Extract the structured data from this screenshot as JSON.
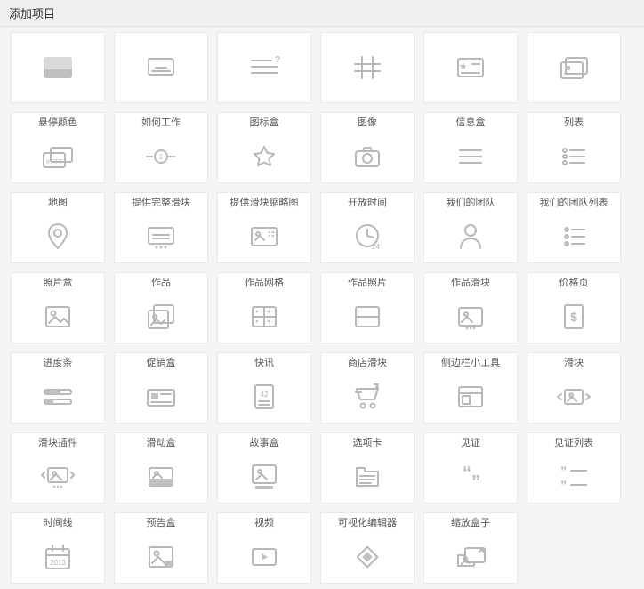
{
  "header": {
    "title": "添加项目"
  },
  "tiles": [
    {
      "label": "",
      "icon": "rect-split"
    },
    {
      "label": "",
      "icon": "card-lines"
    },
    {
      "label": "",
      "icon": "lines-question"
    },
    {
      "label": "",
      "icon": "hash"
    },
    {
      "label": "",
      "icon": "card-star"
    },
    {
      "label": "",
      "icon": "media-stack"
    },
    {
      "label": "悬停颜色",
      "icon": "hover-color"
    },
    {
      "label": "如何工作",
      "icon": "how-works"
    },
    {
      "label": "图标盒",
      "icon": "star"
    },
    {
      "label": "图像",
      "icon": "camera"
    },
    {
      "label": "信息盒",
      "icon": "list-lines"
    },
    {
      "label": "列表",
      "icon": "list-dots"
    },
    {
      "label": "地图",
      "icon": "pin"
    },
    {
      "label": "提供完整滑块",
      "icon": "slider-full"
    },
    {
      "label": "提供滑块缩略图",
      "icon": "slider-thumb"
    },
    {
      "label": "开放时间",
      "icon": "clock-24"
    },
    {
      "label": "我们的团队",
      "icon": "person"
    },
    {
      "label": "我们的团队列表",
      "icon": "person-list"
    },
    {
      "label": "照片盒",
      "icon": "image"
    },
    {
      "label": "作品",
      "icon": "image-stack"
    },
    {
      "label": "作品网格",
      "icon": "grid-4"
    },
    {
      "label": "作品照片",
      "icon": "split-h"
    },
    {
      "label": "作品滑块",
      "icon": "image-slider"
    },
    {
      "label": "价格页",
      "icon": "dollar-page"
    },
    {
      "label": "进度条",
      "icon": "progress"
    },
    {
      "label": "促销盒",
      "icon": "promo"
    },
    {
      "label": "快讯",
      "icon": "page-42"
    },
    {
      "label": "商店滑块",
      "icon": "cart"
    },
    {
      "label": "侧边栏小工具",
      "icon": "window"
    },
    {
      "label": "滑块",
      "icon": "slider-arrows"
    },
    {
      "label": "滑块插件",
      "icon": "slider-plugin"
    },
    {
      "label": "滑动盒",
      "icon": "sliding-box"
    },
    {
      "label": "故事盒",
      "icon": "story-box"
    },
    {
      "label": "选项卡",
      "icon": "tabs"
    },
    {
      "label": "见证",
      "icon": "quotes"
    },
    {
      "label": "见证列表",
      "icon": "quotes-list"
    },
    {
      "label": "时间线",
      "icon": "calendar-2013"
    },
    {
      "label": "预告盒",
      "icon": "trailer"
    },
    {
      "label": "视频",
      "icon": "video"
    },
    {
      "label": "可视化编辑器",
      "icon": "diamond"
    },
    {
      "label": "缩放盒子",
      "icon": "zoom-box"
    }
  ]
}
